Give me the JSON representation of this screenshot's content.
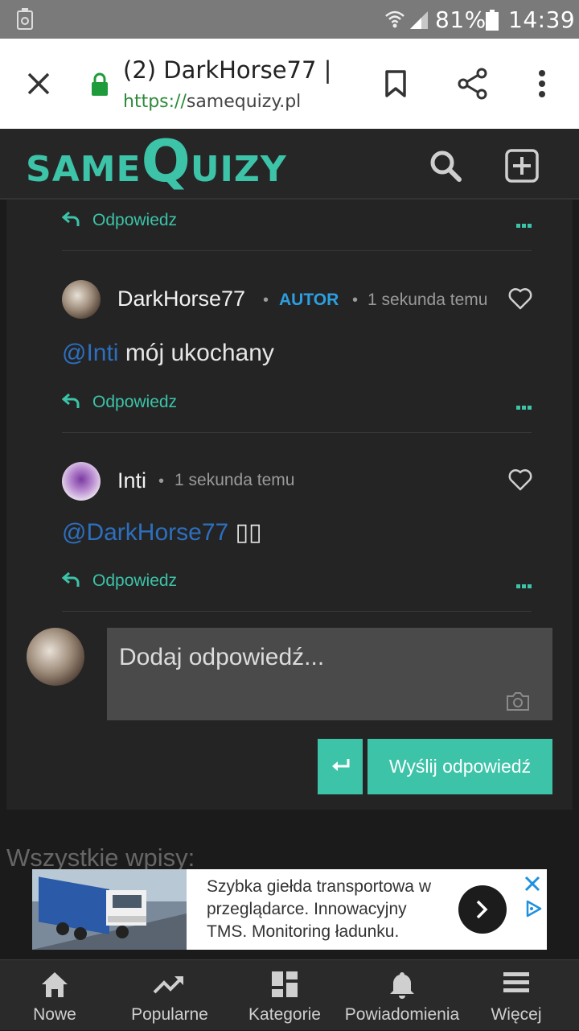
{
  "status_bar": {
    "battery": "81%",
    "time": "14:39"
  },
  "browser": {
    "tab_title": "(2) DarkHorse77 | ...",
    "url_scheme": "https://",
    "url_host": "samequizy.pl"
  },
  "site": {
    "logo_small_1": "SAME",
    "logo_big": "Q",
    "logo_small_2": "UIZY"
  },
  "comments": {
    "reply_label": "Odpowiedz",
    "items": [
      {
        "username": "DarkHorse77",
        "badge": "AUTOR",
        "time": "1 sekunda temu",
        "mention": "@Inti",
        "text": " mój ukochany"
      },
      {
        "username": "Inti",
        "time": "1 sekunda temu",
        "mention": "@DarkHorse77",
        "text": " ▯▯"
      }
    ]
  },
  "reply_form": {
    "placeholder": "Dodaj odpowiedź...",
    "send_label": "Wyślij odpowiedź"
  },
  "all_posts_heading": "Wszystkie wpisy:",
  "ad": {
    "text": "Szybka giełda transportowa w przeglądarce. Innowacyjny TMS. Monitoring ładunku."
  },
  "bottom_nav": [
    {
      "label": "Nowe",
      "icon": "home-icon"
    },
    {
      "label": "Popularne",
      "icon": "trending-icon"
    },
    {
      "label": "Kategorie",
      "icon": "categories-icon"
    },
    {
      "label": "Powiadomienia",
      "icon": "bell-icon"
    },
    {
      "label": "Więcej",
      "icon": "menu-icon"
    }
  ],
  "colors": {
    "accent": "#3cc3a8",
    "mention": "#2d6fbf",
    "author_badge": "#2d9ee0"
  }
}
